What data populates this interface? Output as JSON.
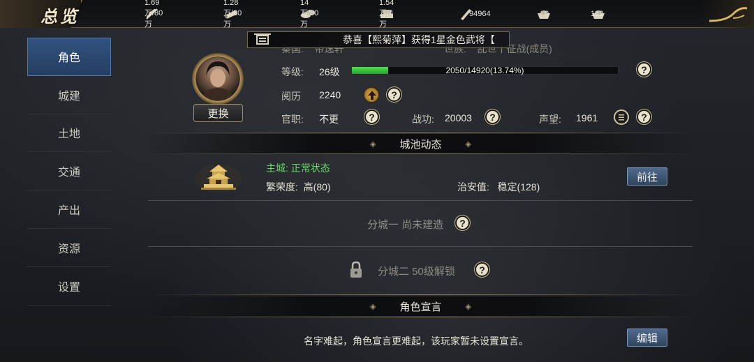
{
  "header": {
    "title": "总览",
    "resources": [
      {
        "icon": "grain-icon",
        "value": "1.69万/80万"
      },
      {
        "icon": "wood-icon",
        "value": "1.28万/80万"
      },
      {
        "icon": "stone-icon",
        "value": "14万/80万"
      },
      {
        "icon": "iron-icon",
        "value": "1.54万/4万"
      },
      {
        "icon": "decree-icon",
        "value": "94964"
      },
      {
        "icon": "gold-ingot-icon",
        "value": "0"
      },
      {
        "icon": "silver-ingot-icon",
        "value": "142"
      }
    ]
  },
  "sidebar": {
    "items": [
      {
        "label": "角色",
        "active": true
      },
      {
        "label": "城建",
        "active": false
      },
      {
        "label": "土地",
        "active": false
      },
      {
        "label": "交通",
        "active": false
      },
      {
        "label": "产出",
        "active": false
      },
      {
        "label": "资源",
        "active": false
      },
      {
        "label": "设置",
        "active": false
      }
    ]
  },
  "broadcast": {
    "message": "恭喜【熙菊萍】获得1星金色武将【"
  },
  "profile": {
    "swap_label": "更换",
    "faded_row": {
      "left": "秦国:    帝逸轩",
      "right": "世族:    乱世丨征战(成员)"
    },
    "level_label": "等级:",
    "level_value": "26级",
    "exp_text": "2050/14920(13.74%)",
    "exp_fraction": 0.1374,
    "experience_label": "阅历",
    "experience_value": "2240",
    "office_label": "官职:",
    "office_value": "不更",
    "merit_label": "战功:",
    "merit_value": "20003",
    "prestige_label": "声望:",
    "prestige_value": "1961",
    "help": "?"
  },
  "city": {
    "section_title": "城池动态",
    "main_city": "主城: 正常状态",
    "prosperity": "繁荣度:  高(80)",
    "security": "治安值:   稳定(128)",
    "goto_label": "前往",
    "branch1": "分城一 尚未建造",
    "branch2": "分城二 50级解锁"
  },
  "manifesto": {
    "section_title": "角色宣言",
    "text": "名字难起，角色宣言更难起，该玩家暂未设置宣言。",
    "edit_label": "编辑"
  },
  "colors": {
    "accent_gold": "#8f7c52",
    "active_tab": "#31527f",
    "status_green": "#69d86a",
    "exp_green": "#3bc43f"
  }
}
